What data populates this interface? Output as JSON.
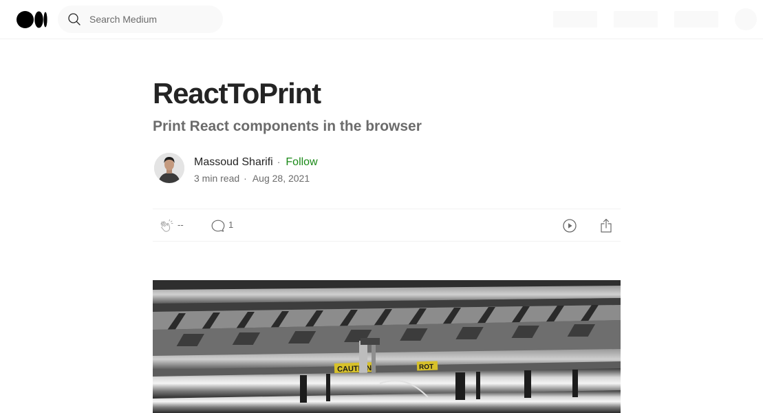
{
  "header": {
    "search_placeholder": "Search Medium"
  },
  "article": {
    "title": "ReactToPrint",
    "subtitle": "Print React components in the browser",
    "author": {
      "name": "Massoud Sharifi",
      "separator": "·",
      "follow_label": "Follow"
    },
    "meta": {
      "read_time": "3 min read",
      "separator": "·",
      "date": "Aug 28, 2021"
    },
    "actions": {
      "clap_count": "--",
      "response_count": "1"
    },
    "hero_image": {
      "signs": [
        "CAUTION",
        "ROT"
      ]
    }
  },
  "colors": {
    "accent_follow": "#1a8917",
    "text_primary": "#242424",
    "text_secondary": "#6b6b6b",
    "placeholder_bg": "#f9f9f9"
  },
  "icons": {
    "logo": "medium-logo-icon",
    "search": "search-icon",
    "clap": "clap-icon",
    "response": "response-icon",
    "listen": "play-icon",
    "share": "share-icon"
  }
}
